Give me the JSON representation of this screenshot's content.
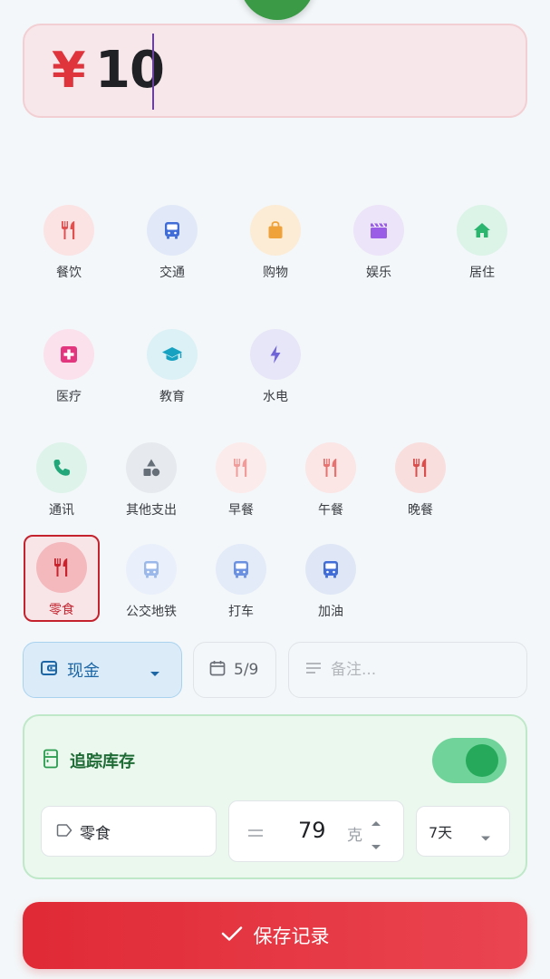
{
  "amount": {
    "currency_symbol": "¥",
    "value": "10"
  },
  "categories": [
    {
      "label": "餐饮",
      "icon": "utensils-icon",
      "bg": "#fbe3e4",
      "color": "#e0504f"
    },
    {
      "label": "交通",
      "icon": "bus-icon",
      "bg": "#e1e9f8",
      "color": "#3f6cd6"
    },
    {
      "label": "购物",
      "icon": "shopping-bag-icon",
      "bg": "#fcecd6",
      "color": "#efa23a"
    },
    {
      "label": "娱乐",
      "icon": "clapperboard-icon",
      "bg": "#ece4f8",
      "color": "#9a5de6"
    },
    {
      "label": "居住",
      "icon": "home-icon",
      "bg": "#dcf3e8",
      "color": "#2bb56f"
    },
    {
      "label": "医疗",
      "icon": "medical-cross-icon",
      "bg": "#fbe1ec",
      "color": "#e2377e"
    },
    {
      "label": "教育",
      "icon": "graduation-cap-icon",
      "bg": "#dcf1f6",
      "color": "#17a2c2"
    },
    {
      "label": "水电",
      "icon": "bolt-icon",
      "bg": "#e7e6f8",
      "color": "#6f63d8"
    },
    {
      "label": "通讯",
      "icon": "phone-icon",
      "bg": "#def3ea",
      "color": "#21a779"
    },
    {
      "label": "其他支出",
      "icon": "shapes-icon",
      "bg": "#e6eaee",
      "color": "#666f78"
    },
    {
      "label": "早餐",
      "icon": "utensils-icon",
      "bg": "#fcebeb",
      "color": "#f09c9a"
    },
    {
      "label": "午餐",
      "icon": "utensils-icon",
      "bg": "#fbe5e5",
      "color": "#e7726f"
    },
    {
      "label": "晚餐",
      "icon": "utensils-icon",
      "bg": "#f9dede",
      "color": "#d94f4d"
    },
    {
      "label": "零食",
      "icon": "utensils-icon",
      "bg": "#f3b9bd",
      "color": "#c8232d",
      "selected": true
    },
    {
      "label": "公交地铁",
      "icon": "bus-icon",
      "bg": "#e9f0fb",
      "color": "#9bb8ea"
    },
    {
      "label": "打车",
      "icon": "bus-icon",
      "bg": "#e3ebf9",
      "color": "#6b90df"
    },
    {
      "label": "加油",
      "icon": "bus-icon",
      "bg": "#dfe7f6",
      "color": "#3f6cd6"
    }
  ],
  "account": {
    "label": "现金",
    "icon": "wallet-icon"
  },
  "date": {
    "label": "5/9",
    "icon": "calendar-icon"
  },
  "note": {
    "placeholder": "备注..."
  },
  "inventory": {
    "title": "追踪库存",
    "enabled": true,
    "item_name": "零食",
    "quantity": "79",
    "unit": "克",
    "expiry": "7天"
  },
  "save": {
    "label": "保存记录"
  },
  "colors": {
    "accent_red": "#e0343d",
    "green": "#26a95a",
    "blue": "#1d66a6"
  }
}
